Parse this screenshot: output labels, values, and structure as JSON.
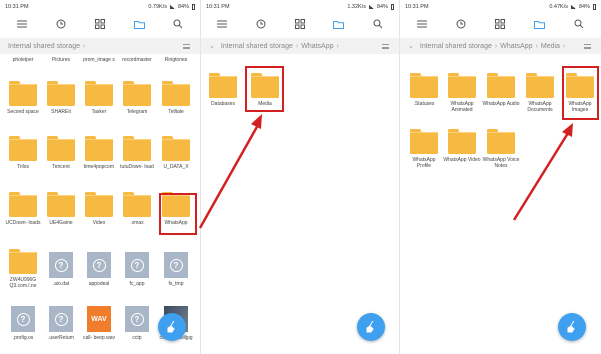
{
  "accent": "#3ea0ee",
  "highlight_color": "#d32020",
  "panels": [
    {
      "status": {
        "time": "10:31 PM",
        "speed": "0.79K/s",
        "battery": "84%"
      },
      "path": [
        "Internal shared storage"
      ],
      "partial_row": [
        "pholetper",
        "Pictures",
        "prom_image s",
        "recordmaster",
        "Ringtones"
      ],
      "items": [
        {
          "label": "Second space",
          "type": "folder"
        },
        {
          "label": "SHAREit",
          "type": "folder"
        },
        {
          "label": "Tasker",
          "type": "folder"
        },
        {
          "label": "Telegram",
          "type": "folder"
        },
        {
          "label": "Telltale",
          "type": "folder"
        },
        {
          "label": "Trilos",
          "type": "folder"
        },
        {
          "label": "Tencent",
          "type": "folder"
        },
        {
          "label": "time4popcorn",
          "type": "folder"
        },
        {
          "label": "tutuDown- load",
          "type": "folder"
        },
        {
          "label": "U_DATA_X",
          "type": "folder"
        },
        {
          "label": "UCDown- loads",
          "type": "folder"
        },
        {
          "label": "UE4Game",
          "type": "folder"
        },
        {
          "label": "Video",
          "type": "folder"
        },
        {
          "label": ".vmax",
          "type": "folder"
        },
        {
          "label": "WhatsApp",
          "type": "folder"
        },
        {
          "label": "ZW4U996G Q3.com.l.ne",
          "type": "folder"
        },
        {
          "label": ".aio.dat",
          "type": "file"
        },
        {
          "label": "appodeal",
          "type": "file"
        },
        {
          "label": "fc_app",
          "type": "file"
        },
        {
          "label": "fs_tmp",
          "type": "file"
        },
        {
          "label": ".profig.os",
          "type": "file"
        },
        {
          "label": ".userReturn",
          "type": "file"
        },
        {
          "label": "call- beep.wav",
          "type": "wav",
          "badge": "WAV"
        },
        {
          "label": "cctp",
          "type": "file"
        },
        {
          "label": "cheap webiljpg",
          "type": "image"
        }
      ]
    },
    {
      "status": {
        "time": "10:31 PM",
        "speed": "1.32K/s",
        "battery": "84%"
      },
      "path": [
        "Internal shared storage",
        "WhatsApp"
      ],
      "items": [
        {
          "label": "Databases",
          "type": "folder"
        },
        {
          "label": "Media",
          "type": "folder"
        }
      ]
    },
    {
      "status": {
        "time": "10:31 PM",
        "speed": "0.47K/s",
        "battery": "84%"
      },
      "path": [
        "Internal shared storage",
        "WhatsApp",
        "Media"
      ],
      "items": [
        {
          "label": ".Statuses",
          "type": "folder"
        },
        {
          "label": "WhatsApp Animated",
          "type": "folder"
        },
        {
          "label": "WhatsApp Audio",
          "type": "folder"
        },
        {
          "label": "WhatsApp Documents",
          "type": "folder"
        },
        {
          "label": "WhatsApp Images",
          "type": "folder"
        },
        {
          "label": "WhatsApp Profile",
          "type": "folder"
        },
        {
          "label": "WhatsApp Video",
          "type": "folder"
        },
        {
          "label": "WhatsApp Voice Notes",
          "type": "folder"
        }
      ]
    }
  ]
}
